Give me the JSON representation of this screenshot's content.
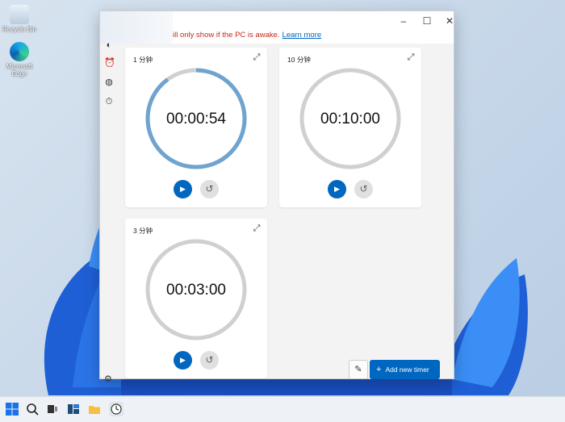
{
  "desktop": {
    "icons": [
      {
        "label": "Recycle Bin"
      },
      {
        "label": "Microsoft Edge"
      }
    ]
  },
  "window": {
    "notice_text": "ill only show if the PC is awake.",
    "notice_link": "Learn more",
    "controls": {
      "minimize": "–",
      "maximize": "☐",
      "close": "✕"
    }
  },
  "timers": [
    {
      "label": "1 分钟",
      "time": "00:00:54",
      "progress": 0.9,
      "running_color": "#6fa4d0"
    },
    {
      "label": "10 分钟",
      "time": "00:10:00",
      "progress": 0
    },
    {
      "label": "3 分钟",
      "time": "00:03:00",
      "progress": 0
    }
  ],
  "actions": {
    "add_timer": "Add new timer"
  },
  "colors": {
    "accent": "#0067c0",
    "ring_idle": "#d0d0d0",
    "notice": "#c42b1c"
  }
}
